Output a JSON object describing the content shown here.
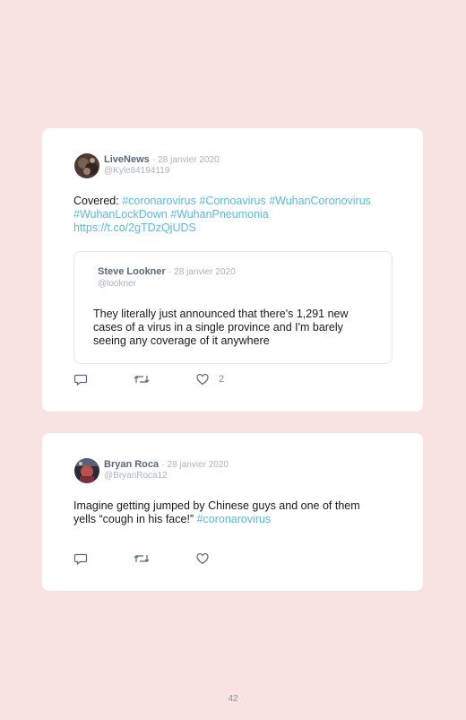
{
  "tweets": [
    {
      "author": "LiveNews",
      "separator": "·",
      "date": "28 janvier 2020",
      "handle": "@Kyle84194119",
      "text_plain": "Covered: ",
      "tags": [
        "#coronarovirus",
        "#Cornoavirus",
        "#WuhanCoronovirus",
        "#WuhanLockDown",
        "#WuhanPneumonia"
      ],
      "link": "https://t.co/2gTDzQjUDS",
      "quoted": {
        "author": "Steve Lookner",
        "separator": "·",
        "date": "28 janvier 2020",
        "handle": "@lookner",
        "line1": "They literally just announced that there's 1,291 new",
        "line2": "cases of a virus in a single province and I'm barely",
        "line3": "seeing any coverage of it anywhere"
      },
      "like_count": "2"
    },
    {
      "author": "Bryan Roca",
      "separator": "·",
      "date": "28 janvier 2020",
      "handle": "@BryanRoca12",
      "line1": "Imagine getting jumped by Chinese guys and one of them",
      "line2_plain": "yells “cough in his face!” ",
      "line2_tag": "#coronarovirus",
      "like_count": ""
    }
  ],
  "icons": {
    "reply": "reply-icon",
    "retweet": "retweet-icon",
    "like": "heart-icon"
  },
  "colors": {
    "page_background": "#f9e2e2",
    "card": "#ffffff",
    "hashtag": "#5bb8e6",
    "author": "#5a6978",
    "muted": "#aab3bc"
  },
  "page_number": "42"
}
